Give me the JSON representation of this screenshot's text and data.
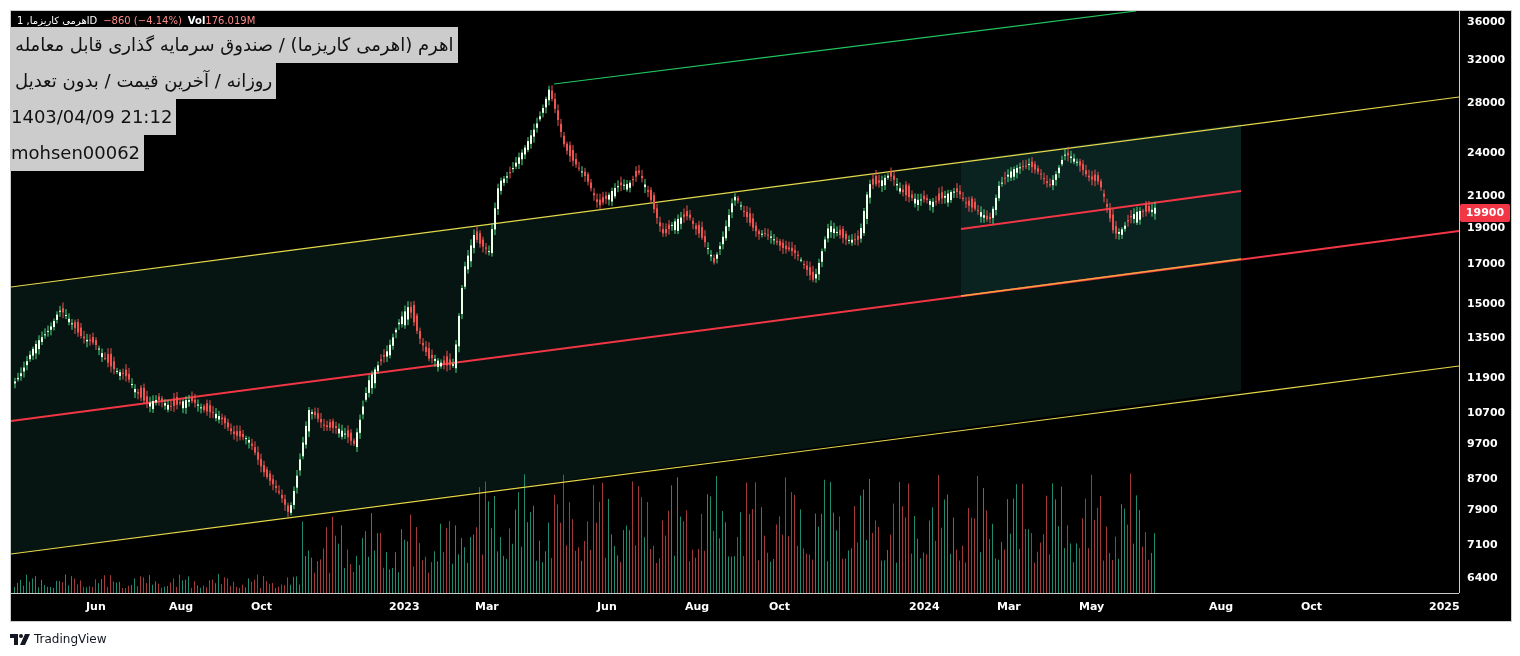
{
  "legend": {
    "symbol": "اهرمی کاریزما, 1D",
    "change": "−860 (−4.14%)",
    "vol_label": "Vol",
    "vol_value": "176.019M"
  },
  "info_box": [
    "اهرم (اهرمی کاریزما) / صندوق سرمایه گذاری قابل معامله",
    "روزانه / آخرین قیمت / بدون تعدیل",
    "1403/04/09 21:12",
    "mohsen00062"
  ],
  "y_axis": {
    "labels": [
      "36000",
      "32000",
      "28000",
      "24000",
      "21000",
      "19000",
      "17000",
      "15000",
      "13500",
      "11900",
      "10700",
      "9700",
      "8700",
      "7900",
      "7100",
      "6400"
    ]
  },
  "price_tag": "19900",
  "x_axis": {
    "labels": [
      "Jun",
      "Aug",
      "Oct",
      "2023",
      "Mar",
      "Jun",
      "Aug",
      "Oct",
      "2024",
      "Mar",
      "May",
      "Aug",
      "Oct",
      "2025"
    ]
  },
  "brand": "TradingView"
}
